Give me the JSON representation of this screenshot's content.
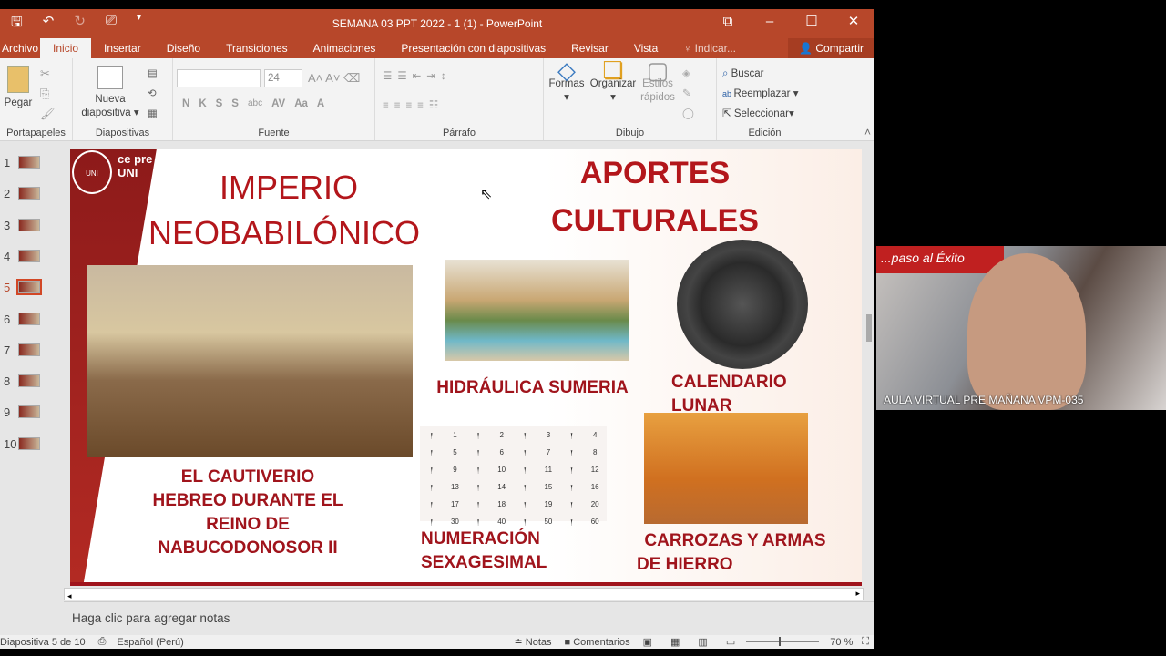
{
  "window": {
    "title": "SEMANA 03 PPT 2022 - 1 (1) - PowerPoint"
  },
  "tabs": [
    "Archivo",
    "Inicio",
    "Insertar",
    "Diseño",
    "Transiciones",
    "Animaciones",
    "Presentación con diapositivas",
    "Revisar",
    "Vista",
    "Indicar..."
  ],
  "share": "Compartir",
  "ribbon": {
    "portapapeles": {
      "label": "Portapapeles",
      "paste": "Pegar"
    },
    "diapositivas": {
      "label": "Diapositivas",
      "new_slide_1": "Nueva",
      "new_slide_2": "diapositiva"
    },
    "fuente": {
      "label": "Fuente",
      "size": "24",
      "bold": "N",
      "italic": "K",
      "underline": "S",
      "shadow": "S",
      "strike": "abc",
      "aa": "Aa",
      "a": "A"
    },
    "parrafo": {
      "label": "Párrafo"
    },
    "dibujo": {
      "label": "Dibujo",
      "formas": "Formas",
      "organizar": "Organizar",
      "estilos1": "Estilos",
      "estilos2": "rápidos"
    },
    "edicion": {
      "label": "Edición",
      "buscar": "Buscar",
      "reemplazar": "Reemplazar",
      "seleccionar": "Seleccionar"
    }
  },
  "thumbnails": [
    "1",
    "2",
    "3",
    "4",
    "5",
    "6",
    "7",
    "8",
    "9",
    "10"
  ],
  "selected_slide": 5,
  "slide": {
    "logo_text": "ce pre UNI",
    "title1": "IMPERIO",
    "title2": "NEOBABILÓNICO",
    "title3": "APORTES",
    "title4": "CULTURALES",
    "caption_cautiverio": [
      "EL CAUTIVERIO",
      "HEBREO DURANTE EL",
      "REINO DE",
      "NABUCODONOSOR II"
    ],
    "caption_hidraulica": "HIDRÁULICA SUMERIA",
    "caption_calendario": [
      "CALENDARIO",
      "LUNAR"
    ],
    "caption_numeracion": [
      "NUMERACIÓN",
      "SEXAGESIMAL"
    ],
    "caption_carrozas": [
      "CARROZAS Y ARMAS",
      "DE HIERRO"
    ],
    "numeration": [
      "1",
      "2",
      "3",
      "4",
      "5",
      "6",
      "7",
      "8",
      "9",
      "10",
      "11",
      "12",
      "13",
      "14",
      "15",
      "16",
      "17",
      "18",
      "19",
      "20",
      "30",
      "40",
      "50",
      "60"
    ]
  },
  "notes_placeholder": "Haga clic para agregar notas",
  "status": {
    "slide": "Diapositiva 5 de 10",
    "language": "Español (Perú)",
    "notes": "Notas",
    "comments": "Comentarios",
    "zoom": "70 %"
  },
  "webcam": {
    "caption": "AULA VIRTUAL PRE MAÑANA VPM-035",
    "banner": "...paso al Éxito"
  }
}
